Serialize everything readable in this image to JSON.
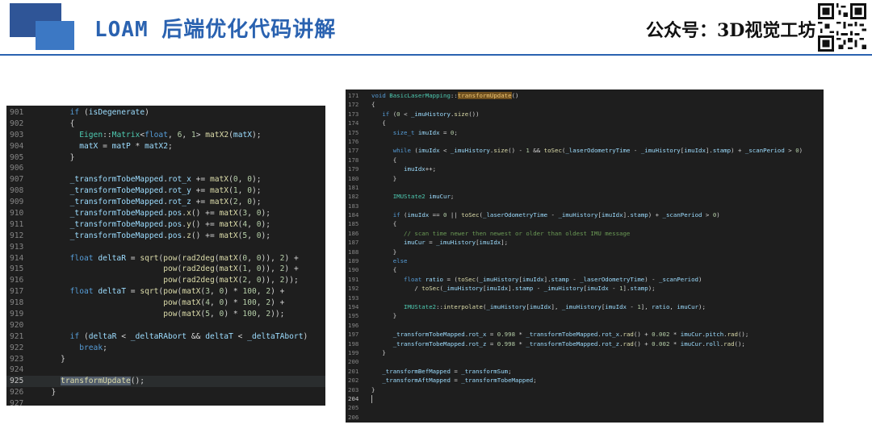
{
  "header": {
    "title": "LOAM 后端优化代码讲解",
    "brand": "公众号：3D视觉工坊"
  },
  "left_code": {
    "active_line": "925",
    "lines": [
      {
        "n": "901",
        "t": "      if (isDegenerate)"
      },
      {
        "n": "902",
        "t": "      {"
      },
      {
        "n": "903",
        "t": "        Eigen::Matrix<float, 6, 1> matX2(matX);"
      },
      {
        "n": "904",
        "t": "        matX = matP * matX2;"
      },
      {
        "n": "905",
        "t": "      }"
      },
      {
        "n": "906",
        "t": ""
      },
      {
        "n": "907",
        "t": "      _transformTobeMapped.rot_x += matX(0, 0);"
      },
      {
        "n": "908",
        "t": "      _transformTobeMapped.rot_y += matX(1, 0);"
      },
      {
        "n": "909",
        "t": "      _transformTobeMapped.rot_z += matX(2, 0);"
      },
      {
        "n": "910",
        "t": "      _transformTobeMapped.pos.x() += matX(3, 0);"
      },
      {
        "n": "911",
        "t": "      _transformTobeMapped.pos.y() += matX(4, 0);"
      },
      {
        "n": "912",
        "t": "      _transformTobeMapped.pos.z() += matX(5, 0);"
      },
      {
        "n": "913",
        "t": ""
      },
      {
        "n": "914",
        "t": "      float deltaR = sqrt(pow(rad2deg(matX(0, 0)), 2) +"
      },
      {
        "n": "915",
        "t": "                          pow(rad2deg(matX(1, 0)), 2) +"
      },
      {
        "n": "916",
        "t": "                          pow(rad2deg(matX(2, 0)), 2));"
      },
      {
        "n": "917",
        "t": "      float deltaT = sqrt(pow(matX(3, 0) * 100, 2) +"
      },
      {
        "n": "918",
        "t": "                          pow(matX(4, 0) * 100, 2) +"
      },
      {
        "n": "919",
        "t": "                          pow(matX(5, 0) * 100, 2));"
      },
      {
        "n": "920",
        "t": ""
      },
      {
        "n": "921",
        "t": "      if (deltaR < _deltaRAbort && deltaT < _deltaTAbort)"
      },
      {
        "n": "922",
        "t": "        break;"
      },
      {
        "n": "923",
        "t": "    }"
      },
      {
        "n": "924",
        "t": ""
      },
      {
        "n": "925",
        "t": "    transformUpdate();"
      },
      {
        "n": "926",
        "t": "  }"
      },
      {
        "n": "927",
        "t": ""
      }
    ]
  },
  "right_code": {
    "active_line": "204",
    "lines": [
      {
        "n": "171",
        "t": "void BasicLaserMapping::transformUpdate()"
      },
      {
        "n": "172",
        "t": "{"
      },
      {
        "n": "173",
        "t": "   if (0 < _imuHistory.size())"
      },
      {
        "n": "174",
        "t": "   {"
      },
      {
        "n": "175",
        "t": "      size_t imuIdx = 0;"
      },
      {
        "n": "176",
        "t": ""
      },
      {
        "n": "177",
        "t": "      while (imuIdx < _imuHistory.size() - 1 && toSec(_laserOdometryTime - _imuHistory[imuIdx].stamp) + _scanPeriod > 0)"
      },
      {
        "n": "178",
        "t": "      {"
      },
      {
        "n": "179",
        "t": "         imuIdx++;"
      },
      {
        "n": "180",
        "t": "      }"
      },
      {
        "n": "181",
        "t": ""
      },
      {
        "n": "182",
        "t": "      IMUState2 imuCur;"
      },
      {
        "n": "183",
        "t": ""
      },
      {
        "n": "184",
        "t": "      if (imuIdx == 0 || toSec(_laserOdometryTime - _imuHistory[imuIdx].stamp) + _scanPeriod > 0)"
      },
      {
        "n": "185",
        "t": "      {"
      },
      {
        "n": "186",
        "t": "         // scan time newer then newest or older than oldest IMU message"
      },
      {
        "n": "187",
        "t": "         imuCur = _imuHistory[imuIdx];"
      },
      {
        "n": "188",
        "t": "      }"
      },
      {
        "n": "189",
        "t": "      else"
      },
      {
        "n": "190",
        "t": "      {"
      },
      {
        "n": "191",
        "t": "         float ratio = (toSec(_imuHistory[imuIdx].stamp - _laserOdometryTime) - _scanPeriod)"
      },
      {
        "n": "192",
        "t": "            / toSec(_imuHistory[imuIdx].stamp - _imuHistory[imuIdx - 1].stamp);"
      },
      {
        "n": "193",
        "t": ""
      },
      {
        "n": "194",
        "t": "         IMUState2::interpolate(_imuHistory[imuIdx], _imuHistory[imuIdx - 1], ratio, imuCur);"
      },
      {
        "n": "195",
        "t": "      }"
      },
      {
        "n": "196",
        "t": ""
      },
      {
        "n": "197",
        "t": "      _transformTobeMapped.rot_x = 0.998 * _transformTobeMapped.rot_x.rad() + 0.002 * imuCur.pitch.rad();"
      },
      {
        "n": "198",
        "t": "      _transformTobeMapped.rot_z = 0.998 * _transformTobeMapped.rot_z.rad() + 0.002 * imuCur.roll.rad();"
      },
      {
        "n": "199",
        "t": "   }"
      },
      {
        "n": "200",
        "t": ""
      },
      {
        "n": "201",
        "t": "   _transformBefMapped = _transformSum;"
      },
      {
        "n": "202",
        "t": "   _transformAftMapped = _transformTobeMapped;"
      },
      {
        "n": "203",
        "t": "}"
      },
      {
        "n": "204",
        "t": ""
      },
      {
        "n": "205",
        "t": ""
      },
      {
        "n": "206",
        "t": ""
      }
    ]
  },
  "colors": {
    "keyword": "#569cd6",
    "type": "#4ec9b0",
    "function": "#dcdcaa",
    "number": "#b5cea8",
    "comment": "#6a9955",
    "variable": "#9cdcfe",
    "text": "#d4d4d4"
  }
}
